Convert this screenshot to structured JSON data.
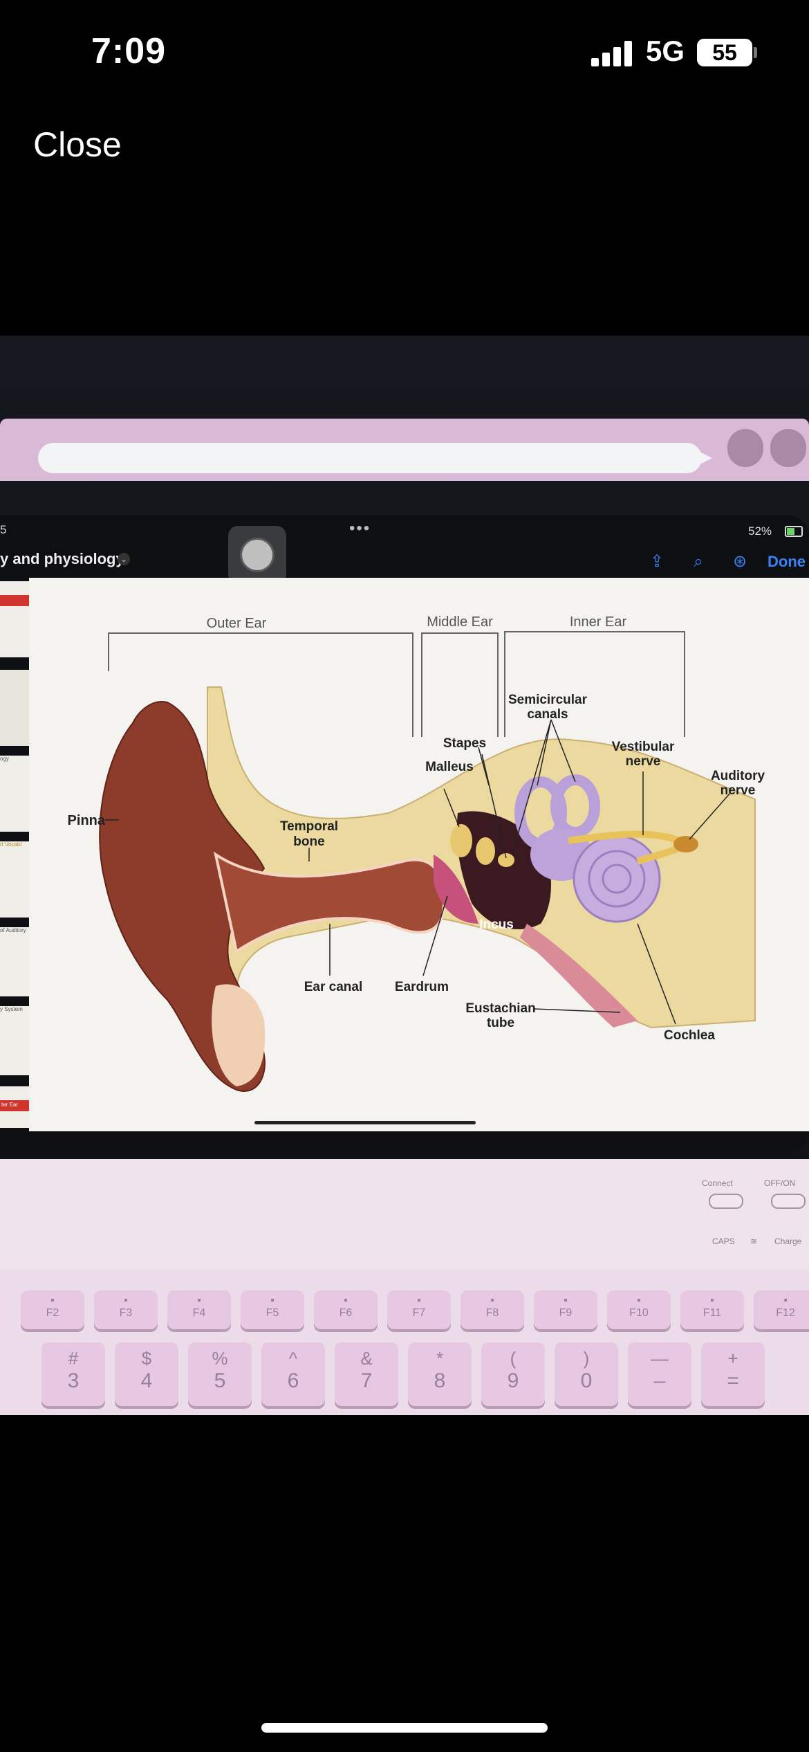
{
  "status_bar": {
    "time": "7:09",
    "network": "5G",
    "battery": "55"
  },
  "nav": {
    "close_label": "Close"
  },
  "ipad": {
    "status": {
      "left_fragment": "5",
      "battery_percent": "52%"
    },
    "doc_title": "y and physiology",
    "done_label": "Done",
    "toolbar_icons": [
      "share-icon",
      "search-icon",
      "markup-icon"
    ]
  },
  "sidebar": {
    "thumb_texts": [
      "ogy",
      "rt Vocabl",
      "of Auditory",
      "y System",
      "ter Ear"
    ]
  },
  "diagram": {
    "section_headers": [
      "Outer Ear",
      "Middle Ear",
      "Inner Ear"
    ],
    "labels": {
      "pinna": "Pinna",
      "temporal_bone_1": "Temporal",
      "temporal_bone_2": "bone",
      "ear_canal": "Ear canal",
      "eardrum": "Eardrum",
      "stapes": "Stapes",
      "malleus": "Malleus",
      "incus": "Incus",
      "semicircular_1": "Semicircular",
      "semicircular_2": "canals",
      "vestibular_1": "Vestibular",
      "vestibular_2": "nerve",
      "auditory_1": "Auditory",
      "auditory_2": "nerve",
      "eustachian_1": "Eustachian",
      "eustachian_2": "tube",
      "cochlea": "Cochlea"
    }
  },
  "keyboard": {
    "panel_labels": {
      "connect": "Connect",
      "onoff": "OFF/ON",
      "caps": "CAPS",
      "charge": "Charge"
    },
    "function_keys": [
      "F2",
      "F3",
      "F4",
      "F5",
      "F6",
      "F7",
      "F8",
      "F9",
      "F10",
      "F11",
      "F12"
    ],
    "number_keys": [
      {
        "top": "#",
        "bottom": "3"
      },
      {
        "top": "$",
        "bottom": "4"
      },
      {
        "top": "%",
        "bottom": "5"
      },
      {
        "top": "^",
        "bottom": "6"
      },
      {
        "top": "&",
        "bottom": "7"
      },
      {
        "top": "*",
        "bottom": "8"
      },
      {
        "top": "(",
        "bottom": "9"
      },
      {
        "top": ")",
        "bottom": "0"
      },
      {
        "top": "—",
        "bottom": "–"
      },
      {
        "top": "+",
        "bottom": "="
      }
    ]
  },
  "colors": {
    "accent": "#3a82f7",
    "keyboard": "#e7c8e2",
    "bone": "#efe0a8",
    "skin": "#8a3a2a"
  }
}
